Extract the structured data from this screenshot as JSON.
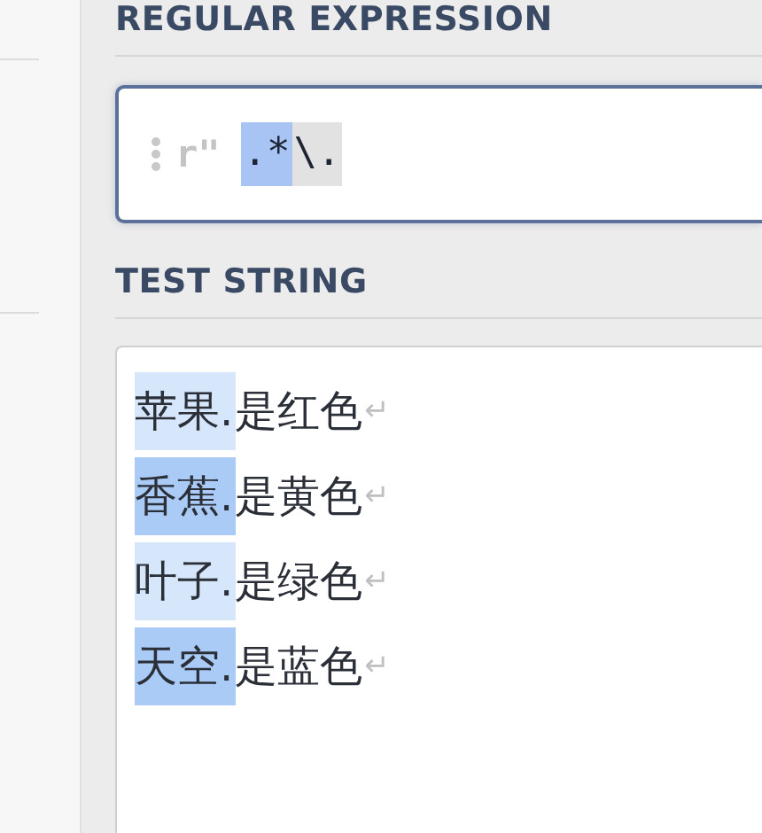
{
  "regex_section": {
    "heading": "REGULAR EXPRESSION",
    "prefix": "r\"",
    "tokens": [
      {
        "text": ".*",
        "color": "#a8c4f5"
      },
      {
        "text": "\\.",
        "color": "#e2e2e2"
      }
    ]
  },
  "test_section": {
    "heading": "TEST STRING",
    "lines": [
      {
        "match": "苹果.",
        "rest": "是红色",
        "eol": "↵",
        "color": "#d6e6fb"
      },
      {
        "match": "香蕉.",
        "rest": "是黄色",
        "eol": "↵",
        "color": "#a9cbf6"
      },
      {
        "match": "叶子.",
        "rest": "是绿色",
        "eol": "↵",
        "color": "#d6e6fb"
      },
      {
        "match": "天空.",
        "rest": "是蓝色",
        "eol": "↵",
        "color": "#a9cbf6"
      }
    ]
  }
}
